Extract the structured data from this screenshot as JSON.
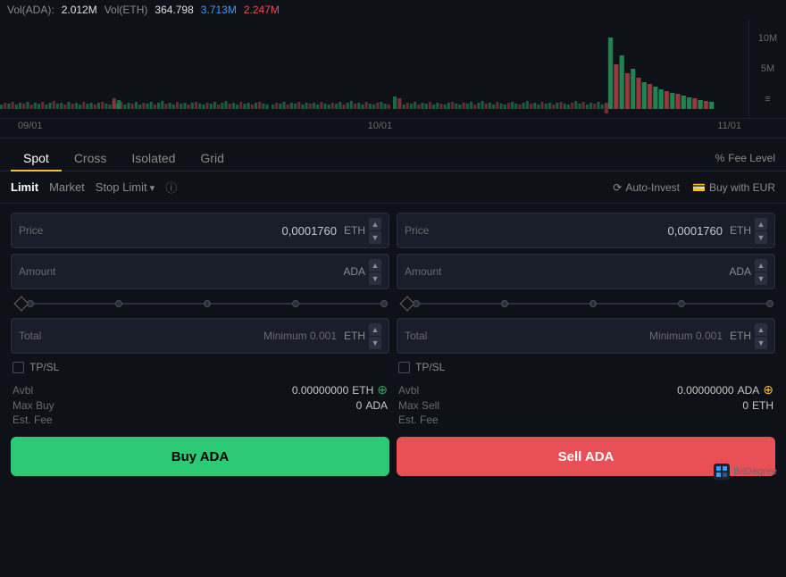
{
  "chart": {
    "vol_label": "Vol(ADA):",
    "vol_ada": "2.012M",
    "vol_eth_label": "Vol(ETH)",
    "vol_eth_1": "364.798",
    "vol_eth_2": "3.713M",
    "vol_eth_3": "2.247M",
    "axis_10m": "10M",
    "axis_5m": "5M",
    "dates": [
      "09/01",
      "10/01",
      "11/01"
    ]
  },
  "tabs": {
    "items": [
      {
        "label": "Spot",
        "active": true
      },
      {
        "label": "Cross",
        "active": false
      },
      {
        "label": "Isolated",
        "active": false
      },
      {
        "label": "Grid",
        "active": false
      }
    ],
    "fee_level": "Fee Level"
  },
  "order_types": {
    "items": [
      {
        "label": "Limit",
        "active": true
      },
      {
        "label": "Market",
        "active": false
      },
      {
        "label": "Stop Limit",
        "has_arrow": true,
        "active": false
      }
    ],
    "info_icon": "ⓘ",
    "auto_invest": "Auto-Invest",
    "buy_with_eur": "Buy with EUR"
  },
  "buy_panel": {
    "price_label": "Price",
    "price_value": "0,0001760",
    "price_currency": "ETH",
    "amount_label": "Amount",
    "amount_value": "",
    "amount_currency": "ADA",
    "total_label": "Total",
    "total_min_label": "Minimum 0.001",
    "total_currency": "ETH",
    "tpsl_label": "TP/SL",
    "avbl_label": "Avbl",
    "avbl_value": "0.00000000",
    "avbl_currency": "ETH",
    "max_buy_label": "Max Buy",
    "max_buy_value": "0",
    "max_buy_currency": "ADA",
    "est_fee_label": "Est. Fee",
    "buy_btn": "Buy ADA"
  },
  "sell_panel": {
    "price_label": "Price",
    "price_value": "0,0001760",
    "price_currency": "ETH",
    "amount_label": "Amount",
    "amount_value": "",
    "amount_currency": "ADA",
    "total_label": "Total",
    "total_min_label": "Minimum 0.001",
    "total_currency": "ETH",
    "tpsl_label": "TP/SL",
    "avbl_label": "Avbl",
    "avbl_value": "0.00000000",
    "avbl_currency": "ADA",
    "max_sell_label": "Max Sell",
    "max_sell_value": "0",
    "max_sell_currency": "ETH",
    "est_fee_label": "Est. Fee",
    "sell_btn": "Sell ADA"
  },
  "watermark": "BitDegree"
}
